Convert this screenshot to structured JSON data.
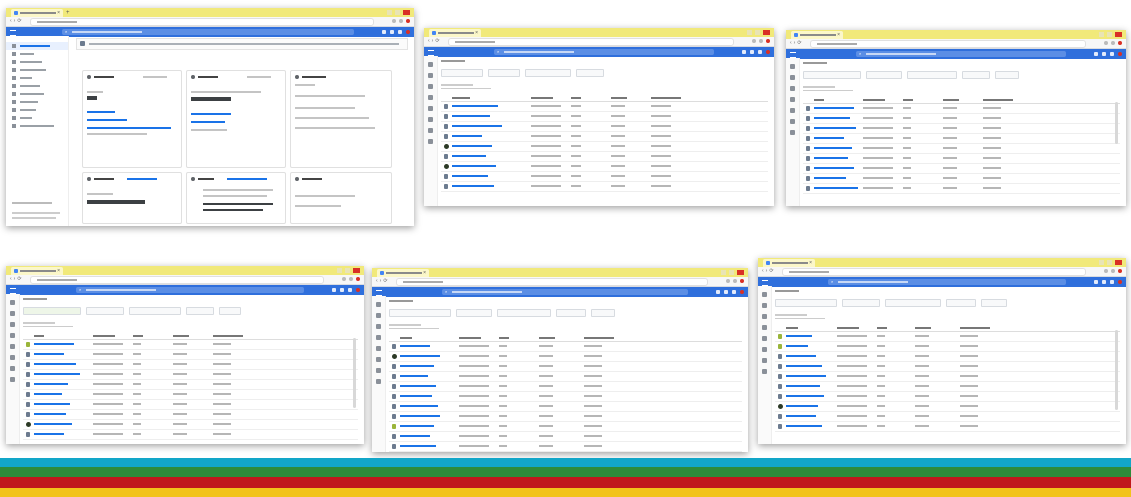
{
  "screens": [
    {
      "id": "dashboard",
      "kind": "dashboard"
    },
    {
      "id": "list-1",
      "kind": "list"
    },
    {
      "id": "list-2",
      "kind": "list"
    },
    {
      "id": "list-3",
      "kind": "list"
    },
    {
      "id": "list-4",
      "kind": "list"
    },
    {
      "id": "list-5",
      "kind": "list"
    }
  ],
  "colors": {
    "app_bar": "#2f6fdc",
    "tab_strip": "#f1e97a",
    "link": "#1a73e8",
    "close": "#d93025",
    "stripe_cyan": "#12a6c8",
    "stripe_green": "#2e8b3a",
    "stripe_red": "#c0181c",
    "stripe_yellow": "#f2c31a"
  },
  "icons": [
    "menu-icon",
    "search-icon",
    "close-icon",
    "avatar-icon",
    "file-icon",
    "folder-icon"
  ]
}
